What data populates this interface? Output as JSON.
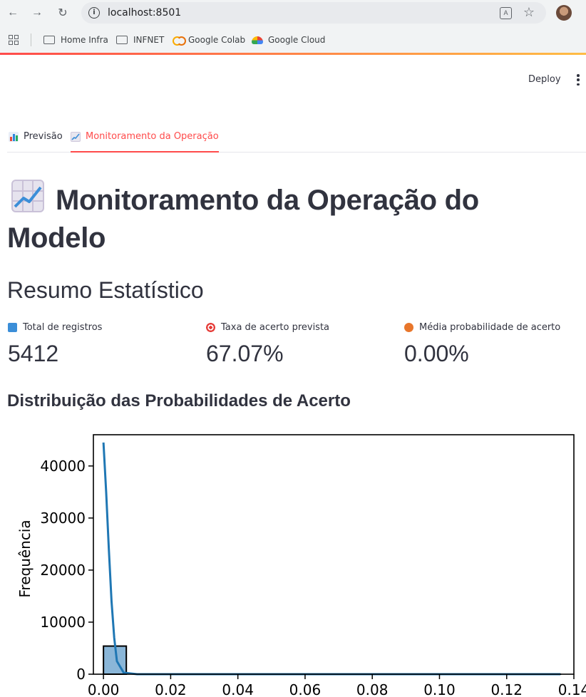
{
  "browser": {
    "url": "localhost:8501",
    "bookmarks": [
      {
        "label": "Home Infra",
        "icon": "folder-icon"
      },
      {
        "label": "INFNET",
        "icon": "folder-icon"
      },
      {
        "label": "Google Colab",
        "icon": "colab-icon"
      },
      {
        "label": "Google Cloud",
        "icon": "google-cloud-icon"
      }
    ]
  },
  "header": {
    "deploy_label": "Deploy"
  },
  "tabs": [
    {
      "label": "Previsão",
      "icon": "bar-chart-icon",
      "active": false
    },
    {
      "label": "Monitoramento da Operação",
      "icon": "chart-increasing-icon",
      "active": true
    }
  ],
  "main": {
    "title": "Monitoramento da Operação do Modelo",
    "title_icon": "chart-increasing-icon",
    "summary_heading": "Resumo Estatístico",
    "metrics": [
      {
        "label": "Total de registros",
        "value": "5412",
        "icon": "input-numbers-icon"
      },
      {
        "label": "Taxa de acerto prevista",
        "value": "67.07%",
        "icon": "direct-hit-icon"
      },
      {
        "label": "Média probabilidade de acerto",
        "value": "0.00%",
        "icon": "basketball-icon"
      }
    ],
    "chart_heading": "Distribuição das Probabilidades de Acerto"
  },
  "colors": {
    "accent": "#ff4b4b",
    "bar_fill": "#8ab6d8",
    "kde_line": "#1f77b4"
  },
  "chart_data": {
    "type": "bar",
    "title": "",
    "xlabel": "",
    "ylabel": "Frequência",
    "xlim": [
      -0.003,
      0.14
    ],
    "ylim": [
      0,
      46000
    ],
    "xticks": [
      "0.00",
      "0.02",
      "0.04",
      "0.06",
      "0.08",
      "0.10",
      "0.12",
      "0.14"
    ],
    "xtick_values": [
      0,
      0.02,
      0.04,
      0.06,
      0.08,
      0.1,
      0.12,
      0.14
    ],
    "yticks": [
      "0",
      "10000",
      "20000",
      "30000",
      "40000"
    ],
    "ytick_values": [
      0,
      10000,
      20000,
      30000,
      40000
    ],
    "bins": [
      {
        "x0": 0.0,
        "x1": 0.0068,
        "count": 5400
      },
      {
        "x0": 0.0068,
        "x1": 0.0136,
        "count": 0
      },
      {
        "x0": 0.0136,
        "x1": 0.0204,
        "count": 0
      },
      {
        "x0": 0.0204,
        "x1": 0.0272,
        "count": 0
      },
      {
        "x0": 0.0272,
        "x1": 0.034,
        "count": 0
      },
      {
        "x0": 0.034,
        "x1": 0.0408,
        "count": 0
      },
      {
        "x0": 0.0408,
        "x1": 0.0476,
        "count": 0
      },
      {
        "x0": 0.0476,
        "x1": 0.0544,
        "count": 0
      },
      {
        "x0": 0.0544,
        "x1": 0.0612,
        "count": 0
      },
      {
        "x0": 0.0612,
        "x1": 0.068,
        "count": 0
      },
      {
        "x0": 0.068,
        "x1": 0.0748,
        "count": 0
      },
      {
        "x0": 0.0748,
        "x1": 0.0816,
        "count": 0
      },
      {
        "x0": 0.0816,
        "x1": 0.0884,
        "count": 0
      },
      {
        "x0": 0.0884,
        "x1": 0.0952,
        "count": 0
      },
      {
        "x0": 0.0952,
        "x1": 0.102,
        "count": 0
      },
      {
        "x0": 0.102,
        "x1": 0.1088,
        "count": 0
      },
      {
        "x0": 0.1088,
        "x1": 0.1156,
        "count": 0
      },
      {
        "x0": 0.1156,
        "x1": 0.1224,
        "count": 0
      },
      {
        "x0": 0.1224,
        "x1": 0.1292,
        "count": 0
      },
      {
        "x0": 0.1292,
        "x1": 0.136,
        "count": 1
      }
    ],
    "kde": {
      "x": [
        0.0,
        0.0008,
        0.0016,
        0.0024,
        0.0032,
        0.004,
        0.006,
        0.01,
        0.02,
        0.04,
        0.06,
        0.08,
        0.1,
        0.12,
        0.136
      ],
      "y": [
        44500,
        35000,
        24000,
        14000,
        7000,
        2500,
        300,
        0,
        0,
        0,
        0,
        0,
        0,
        0,
        0
      ]
    },
    "grid": false,
    "legend": "none"
  }
}
